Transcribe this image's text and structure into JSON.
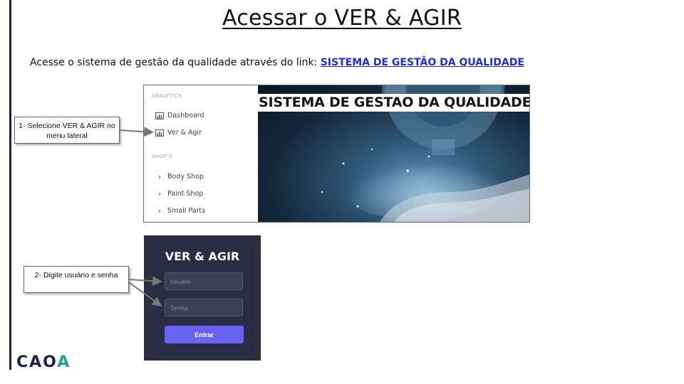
{
  "slide": {
    "title": "Acessar o VER & AGIR",
    "intro_text": "Acesse o sistema de gestão da qualidade através do link: ",
    "intro_link": "SISTEMA DE GESTÃO DA QUALIDADE"
  },
  "dashboard": {
    "sections": [
      {
        "label": "ANALYTICS",
        "items": [
          {
            "label": "Dashboard",
            "icon": "bar-chart-icon"
          },
          {
            "label": "Ver & Agir",
            "icon": "bar-chart-icon"
          }
        ]
      },
      {
        "label": "SHOP'S",
        "items": [
          {
            "label": "Body Shop",
            "icon": "chevron-right-icon"
          },
          {
            "label": "Paint Shop",
            "icon": "chevron-right-icon"
          },
          {
            "label": "Small Parts",
            "icon": "chevron-right-icon"
          }
        ]
      }
    ],
    "banner_title": "SISTEMA DE GESTAO DA QUALIDADE"
  },
  "login": {
    "title": "VER & AGIR",
    "username_placeholder": "Usuário",
    "password_placeholder": "Senha",
    "submit_label": "Entrar"
  },
  "callouts": {
    "step1": "1- Selecione VER & AGIR no menu lateral",
    "step2": "2- Digite usuário e senha"
  },
  "logo": {
    "text_main": "CAO",
    "text_accent": "A"
  },
  "colors": {
    "link": "#1c2fd6",
    "login_button": "#6a63f2",
    "accent_rule": "#1a1f4e",
    "logo_accent": "#1aa88a"
  }
}
